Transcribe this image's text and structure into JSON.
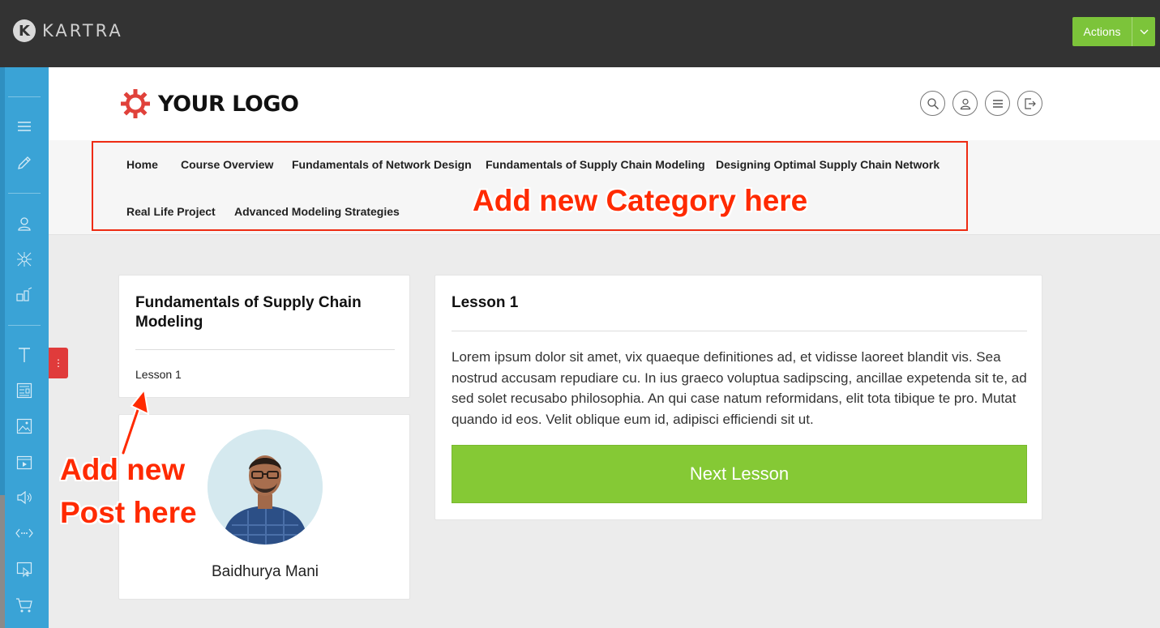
{
  "app": {
    "brand_letter": "K",
    "brand_name": "KARTRA",
    "actions_label": "Actions",
    "accent_color": "#7cc43a"
  },
  "sidebar": {
    "icons": [
      "menu-icon",
      "pencil-icon",
      "user-icon",
      "network-icon",
      "funnel-icon",
      "text-icon",
      "layout-icon",
      "image-icon",
      "video-icon",
      "audio-icon",
      "code-icon",
      "click-icon",
      "cart-icon"
    ]
  },
  "header": {
    "logo_text": "YOUR LOGO",
    "icons": [
      "search-icon",
      "user-icon",
      "menu-icon",
      "logout-icon"
    ]
  },
  "nav": {
    "items": [
      "Home",
      "Course Overview",
      "Fundamentals of Network Design",
      "Fundamentals of Supply Chain Modeling",
      "Designing Optimal Supply Chain Network",
      "Real Life Project",
      "Advanced Modeling Strategies"
    ]
  },
  "annotations": {
    "category": "Add new Category here",
    "post_line1": "Add new",
    "post_line2": "Post here",
    "color": "#ff2a00"
  },
  "category_card": {
    "title": "Fundamentals of Supply Chain Modeling",
    "lessons": [
      "Lesson 1"
    ]
  },
  "author_card": {
    "name": "Baidhurya Mani"
  },
  "lesson_card": {
    "title": "Lesson 1",
    "body": "Lorem ipsum dolor sit amet, vix quaeque definitiones ad, et vidisse laoreet blandit vis. Sea nostrud accusam repudiare cu. In ius graeco voluptua sadipscing, ancillae expetenda sit te, ad sed solet recusabo philosophia. An qui case natum reformidans, elit tota tibique te pro. Mutat quando id eos. Velit oblique eum id, adipisci efficiendi sit ut.",
    "next_button": "Next Lesson"
  }
}
